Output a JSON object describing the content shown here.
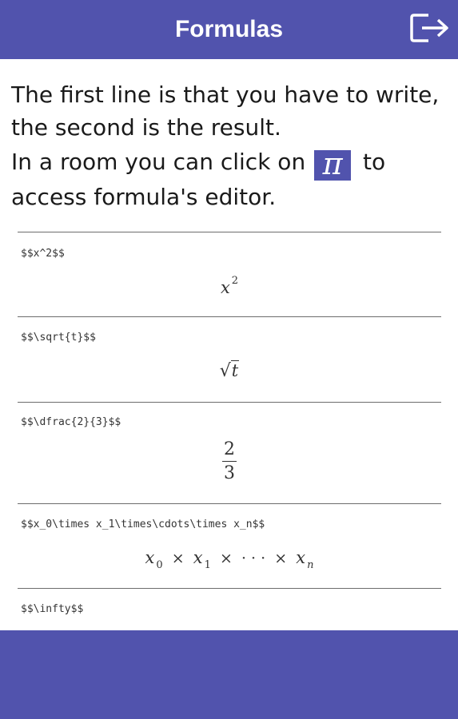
{
  "header": {
    "title": "Formulas",
    "exit_icon": "exit-icon"
  },
  "intro": {
    "line1": "The first line is that you have to write, the second is the result.",
    "line2_before": "In a room you can click on",
    "pi_symbol": "π",
    "line2_after": "to access formula's editor."
  },
  "formulas": [
    {
      "code": "$$x^2$$",
      "result": {
        "base": "x",
        "sup": "2"
      }
    },
    {
      "code": "$$\\sqrt{t}$$",
      "result": {
        "radical": "√",
        "body": "t"
      }
    },
    {
      "code": "$$\\dfrac{2}{3}$$",
      "result": {
        "num": "2",
        "den": "3"
      }
    },
    {
      "code": "$$x_0\\times x_1\\times\\cdots\\times x_n$$",
      "result": {
        "x0": "x",
        "s0": "0",
        "t1": "×",
        "x1": "x",
        "s1": "1",
        "t2": "×",
        "dots": "· · ·",
        "t3": "×",
        "xn": "x",
        "sn": "n"
      }
    },
    {
      "code": "$$\\infty$$"
    }
  ],
  "colors": {
    "primary": "#5153ad",
    "background": "#ffffff",
    "text": "#1a1a1a"
  }
}
